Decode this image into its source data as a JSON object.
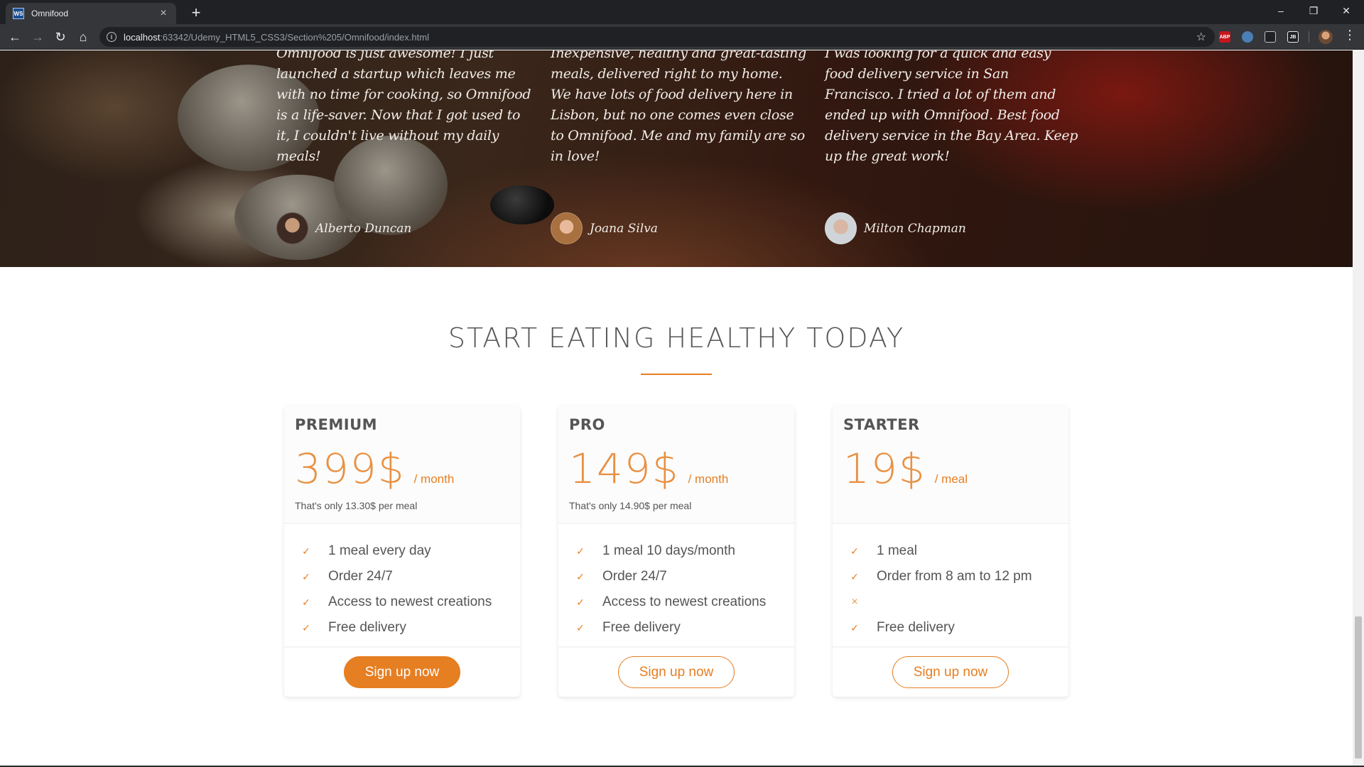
{
  "browser": {
    "tab_title": "Omnifood",
    "tab_favicon": "WS",
    "url_host": "localhost",
    "url_path": ":63342/Udemy_HTML5_CSS3/Section%205/Omnifood/index.html",
    "extensions": [
      "ABP",
      "ext-2",
      "ext-3",
      "JB"
    ]
  },
  "testimonials": [
    {
      "quote": "Omnifood is just awesome! I just launched a startup which leaves me with no time for cooking, so Omnifood is a life-saver. Now that I got used to it, I couldn't live without my daily meals!",
      "author": "Alberto Duncan"
    },
    {
      "quote": "Inexpensive, healthy and great-tasting meals, delivered right to my home. We have lots of food delivery here in Lisbon, but no one comes even close to Omnifood. Me and my family are so in love!",
      "author": "Joana Silva"
    },
    {
      "quote": "I was looking for a quick and easy food delivery service in San Francisco. I tried a lot of them and ended up with Omnifood. Best food delivery service in the Bay Area. Keep up the great work!",
      "author": "Milton Chapman"
    }
  ],
  "plans": {
    "title": "START EATING HEALTHY TODAY",
    "items": [
      {
        "name": "PREMIUM",
        "price": "399$",
        "unit": "/ month",
        "note": "That's only 13.30$ per meal",
        "features": [
          "1 meal every day",
          "Order 24/7",
          "Access to newest creations",
          "Free delivery"
        ],
        "cta": "Sign up now"
      },
      {
        "name": "PRO",
        "price": "149$",
        "unit": "/ month",
        "note": "That's only 14.90$ per meal",
        "features": [
          "1 meal 10 days/month",
          "Order 24/7",
          "Access to newest creations",
          "Free delivery"
        ],
        "cta": "Sign up now"
      },
      {
        "name": "STARTER",
        "price": "19$",
        "unit": "/ meal",
        "note": "",
        "features": [
          "1 meal",
          "Order from 8 am to 12 pm",
          "",
          "Free delivery"
        ],
        "cta": "Sign up now"
      }
    ]
  },
  "colors": {
    "accent": "#e67e22",
    "text": "#555555",
    "chrome": "#35363a"
  },
  "icons": {
    "check": "checkmark-icon",
    "cross": "cross-icon"
  }
}
